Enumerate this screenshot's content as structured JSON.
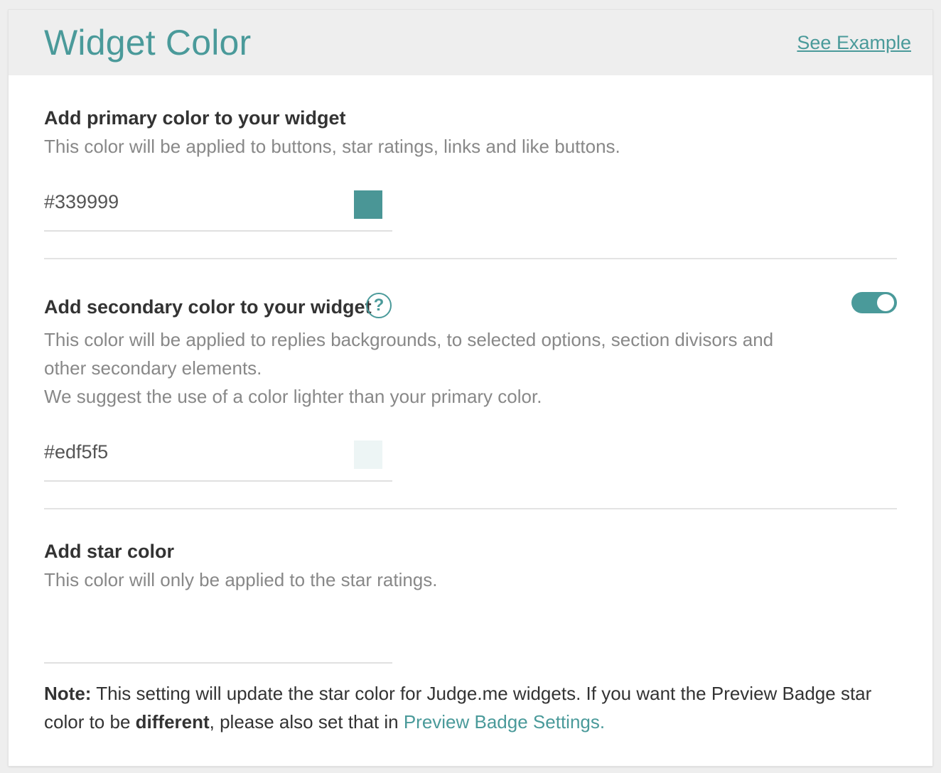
{
  "header": {
    "title": "Widget Color",
    "see_example": "See Example"
  },
  "primary": {
    "heading": "Add primary color to your widget",
    "description": "This color will be applied to buttons, star ratings, links and like buttons.",
    "value": "#339999",
    "swatch_color": "#4a9696"
  },
  "secondary": {
    "heading": "Add secondary color to your widget",
    "help_icon": "?",
    "toggle_on": true,
    "description_line1": "This color will be applied to replies backgrounds, to selected options, section divisors and",
    "description_line2": "other secondary elements.",
    "description_line3": "We suggest the use of a color lighter than your primary color.",
    "value": "#edf5f5",
    "swatch_color": "#edf5f5"
  },
  "star": {
    "heading": "Add star color",
    "description": "This color will only be applied to the star ratings.",
    "value": ""
  },
  "note": {
    "label": "Note:",
    "text1": " This setting will update the star color for Judge.me widgets. If you want the Preview Badge star color to be ",
    "emphasis": "different",
    "text2": ", please also set that in ",
    "link": "Preview Badge Settings."
  },
  "colors": {
    "accent": "#4a9a9a",
    "heading": "#333333",
    "muted": "#888888"
  }
}
